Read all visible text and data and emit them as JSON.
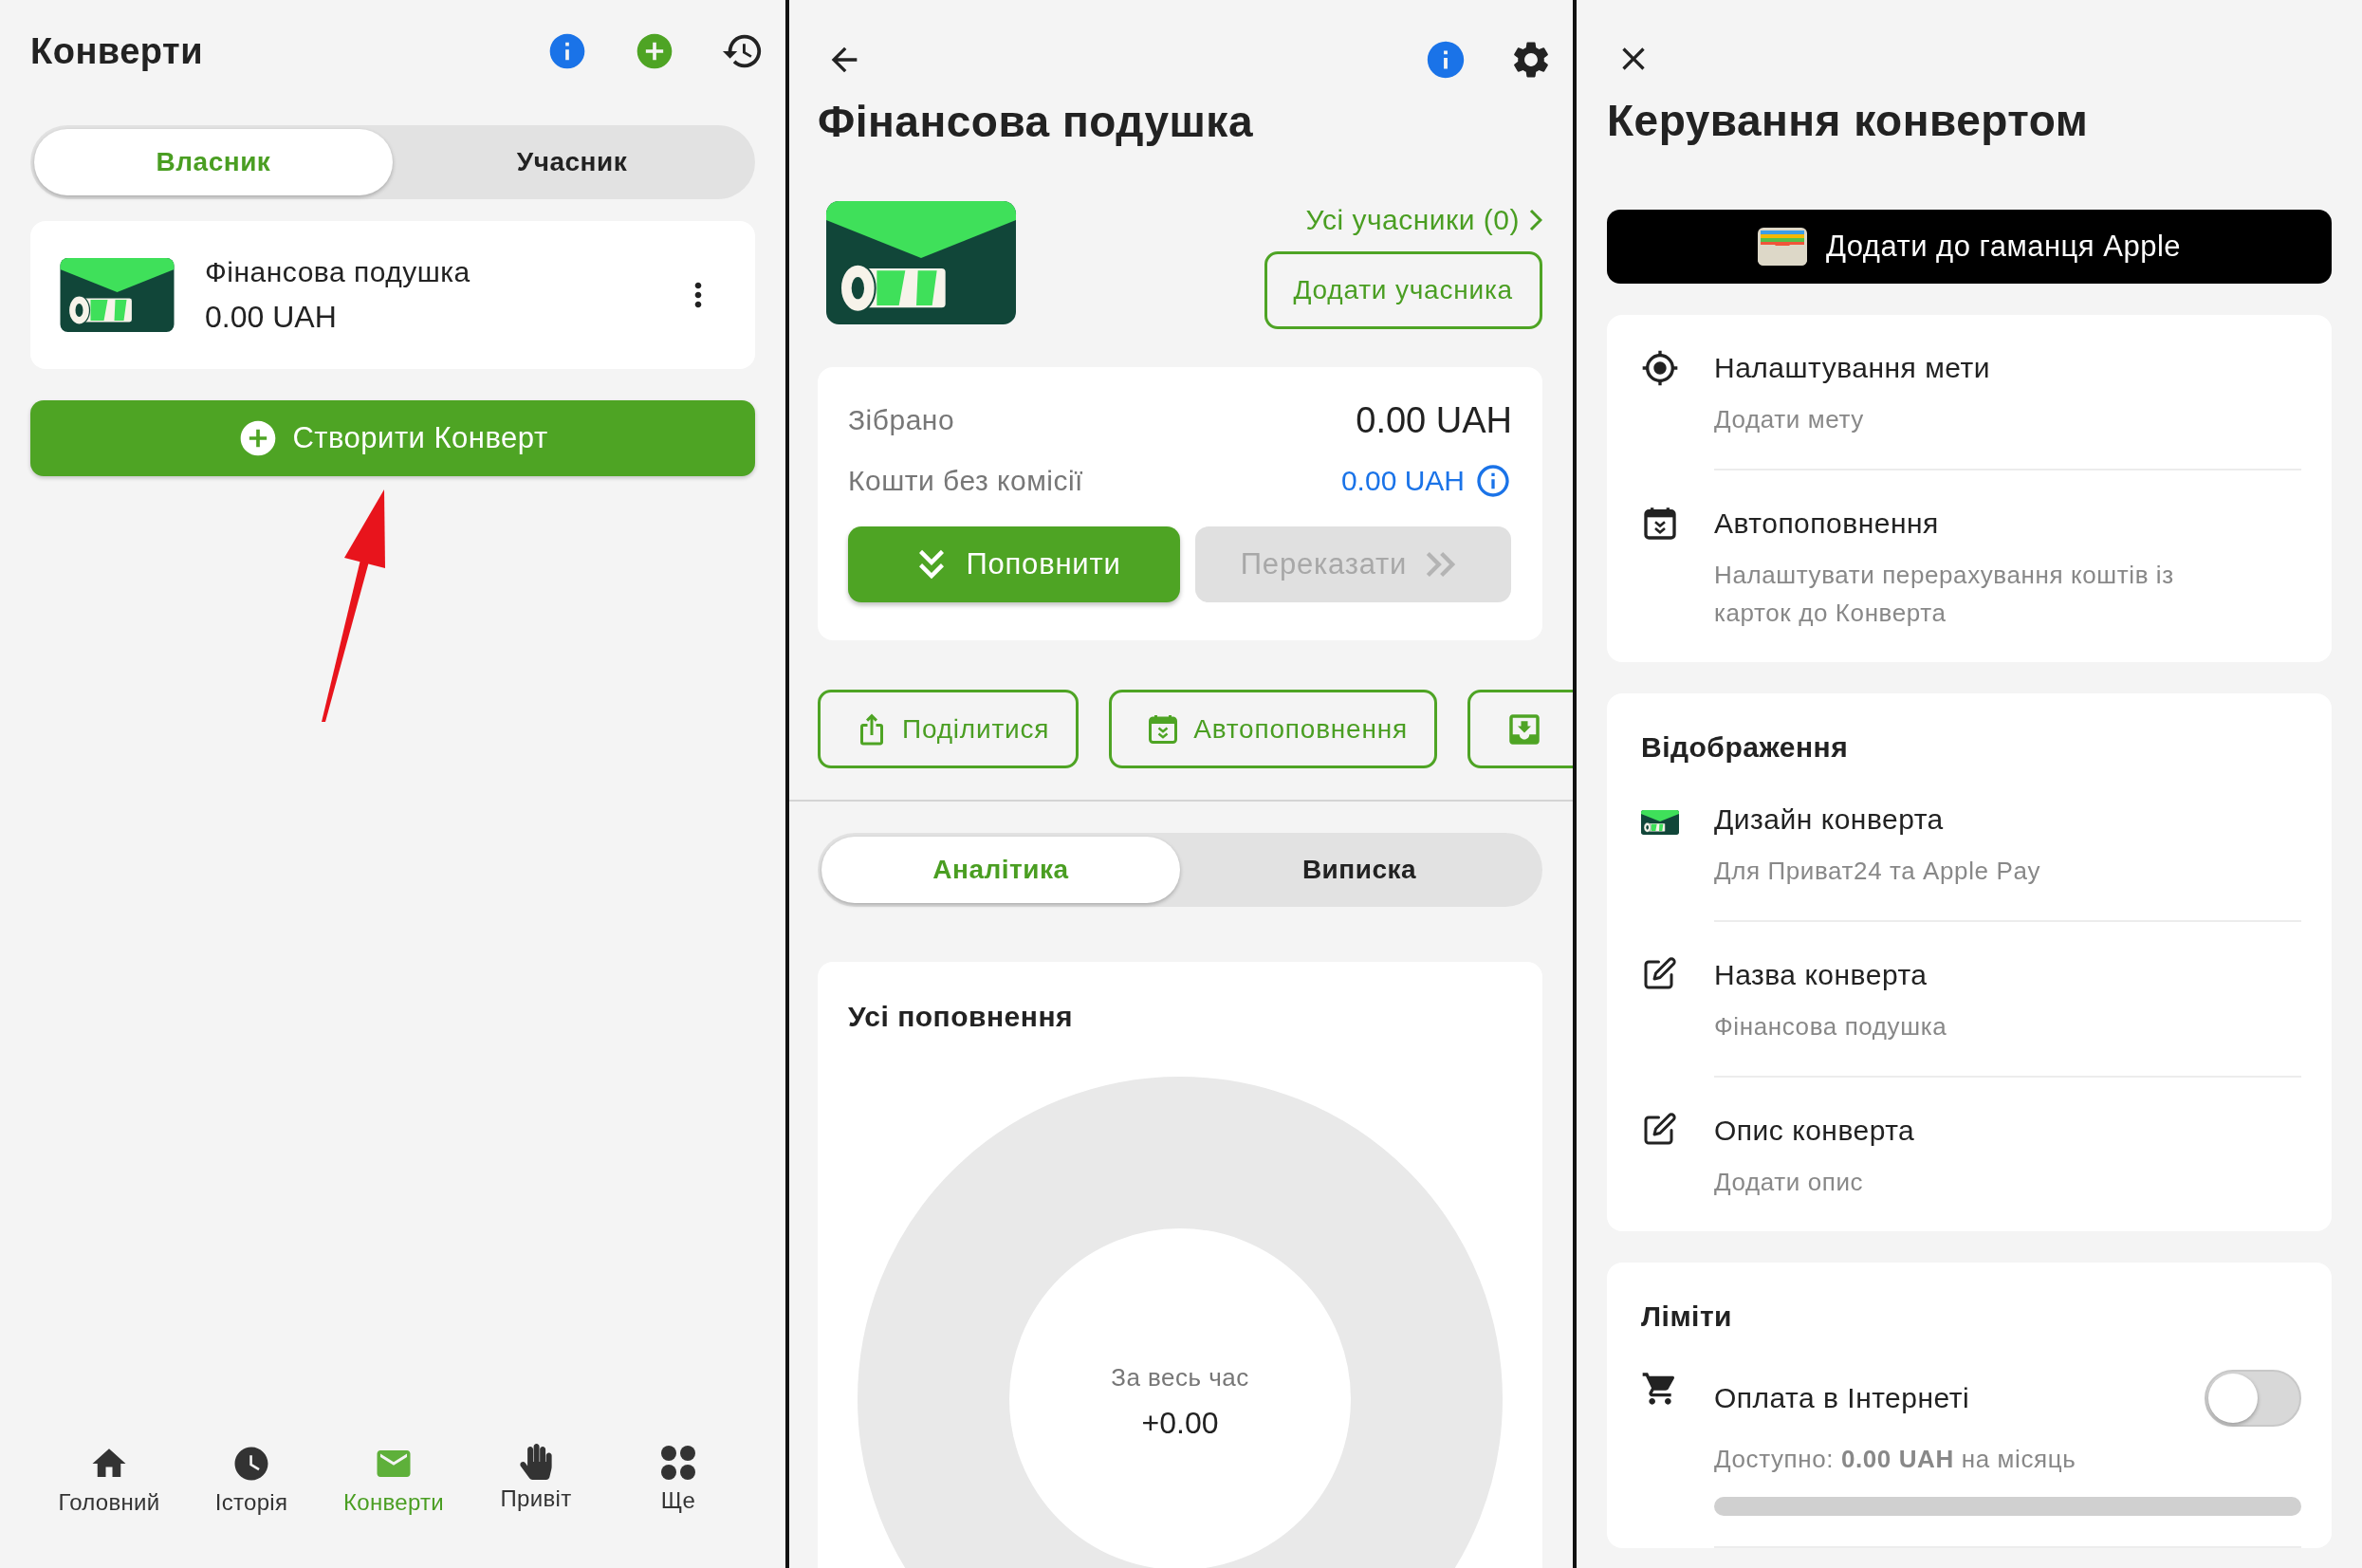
{
  "envelopes_screen": {
    "title": "Конверти",
    "tabs": [
      {
        "label": "Власник",
        "selected": true
      },
      {
        "label": "Учасник",
        "selected": false
      }
    ],
    "envelopes": [
      {
        "name": "Фінансова подушка",
        "amount": "0.00 UAH"
      }
    ],
    "create_button": "Створити Конверт",
    "bottom_nav": [
      {
        "label": "Головний",
        "selected": false
      },
      {
        "label": "Історія",
        "selected": false
      },
      {
        "label": "Конверти",
        "selected": true
      },
      {
        "label": "Привіт",
        "selected": false
      },
      {
        "label": "Ще",
        "selected": false
      }
    ]
  },
  "envelope_screen": {
    "title": "Фінансова подушка",
    "members_link": "Усі учасники (0)",
    "add_member_button": "Додати учасника",
    "balance": [
      {
        "label": "Зібрано",
        "value": "0.00 UAH",
        "kind": "total"
      },
      {
        "label": "Кошти без комісії",
        "value": "0.00 UAH",
        "kind": "info"
      }
    ],
    "buttons": [
      {
        "label": "Поповнити",
        "disabled": false
      },
      {
        "label": "Переказати",
        "disabled": true
      }
    ],
    "actions": [
      "Поділитися",
      "Автопоповнення"
    ],
    "tabs": [
      {
        "label": "Аналітика",
        "selected": true
      },
      {
        "label": "Виписка",
        "selected": false
      }
    ],
    "chart": {
      "title": "Усі поповнення",
      "caption": "За весь час",
      "total": "+0.00"
    }
  },
  "manage_screen": {
    "title": "Керування конвертом",
    "wallet_button": "Додати до гаманця Apple",
    "sections": [
      {
        "rows": [
          {
            "kind": "link",
            "title": "Налаштування мети",
            "subtitle": "Додати мету"
          },
          {
            "kind": "link",
            "title": "Автопоповнення",
            "subtitle": "Налаштувати перерахування коштів із карток до Конверта"
          }
        ]
      },
      {
        "heading": "Відображення",
        "rows": [
          {
            "kind": "link",
            "title": "Дизайн конверта",
            "subtitle": "Для Приват24 та Apple Pay"
          },
          {
            "kind": "link",
            "title": "Назва конверта",
            "subtitle": "Фінансова подушка"
          },
          {
            "kind": "link",
            "title": "Опис конверта",
            "subtitle": "Додати опис"
          }
        ]
      },
      {
        "heading": "Ліміти",
        "rows": [
          {
            "kind": "limit",
            "title": "Оплата в Інтернеті",
            "subtitle": "Доступно: **0.00 UAH** на місяць",
            "on": false,
            "level": 0
          }
        ]
      }
    ]
  }
}
